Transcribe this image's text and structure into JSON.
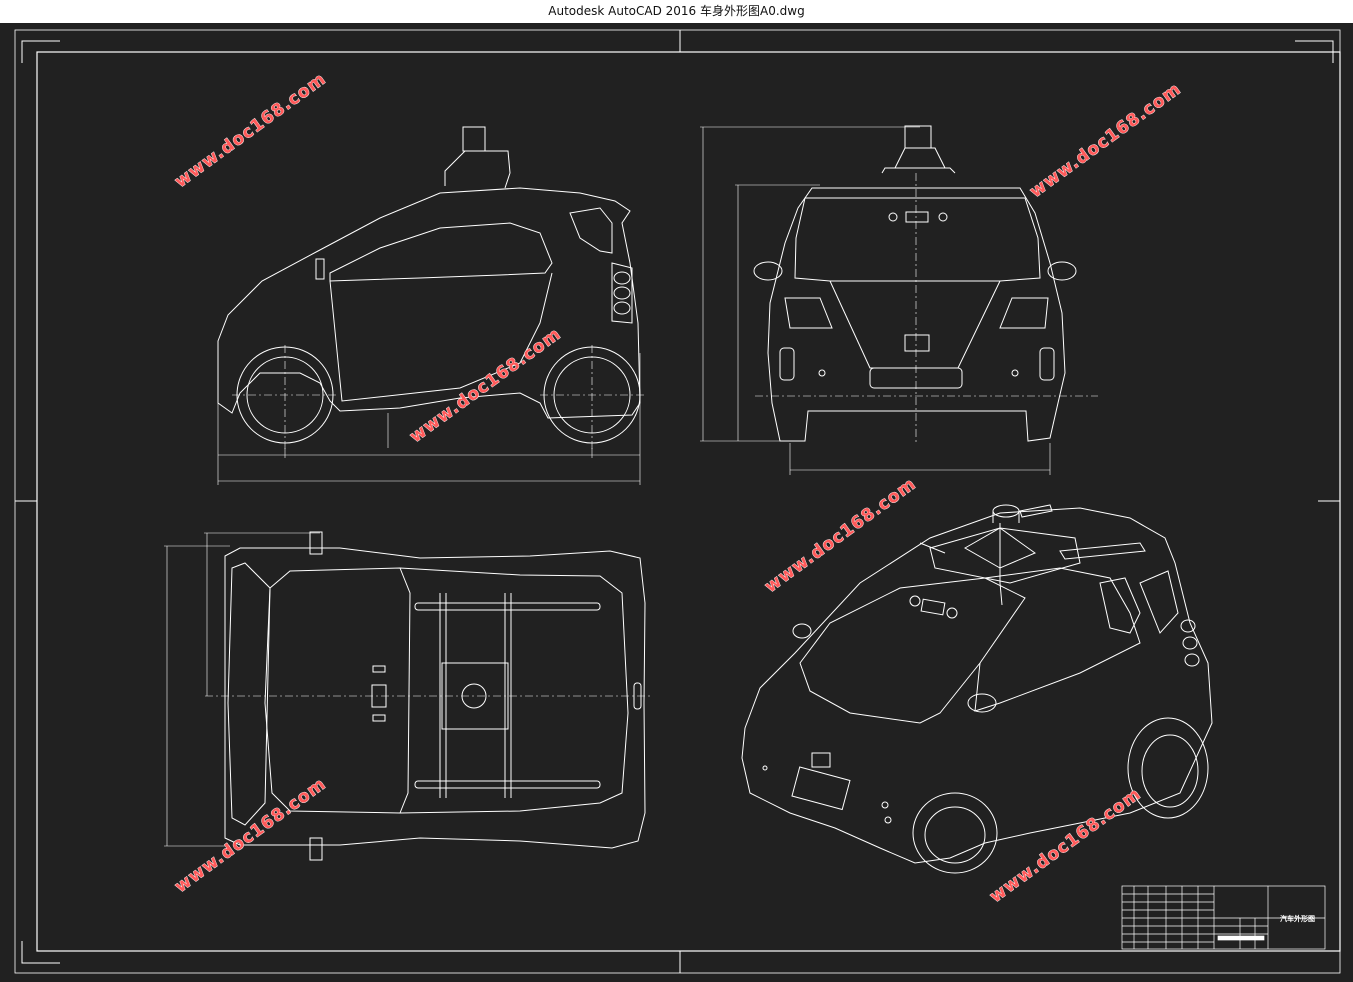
{
  "window": {
    "title": "Autodesk AutoCAD 2016    车身外形图A0.dwg"
  },
  "drawing": {
    "watermark": "www.doc168.com",
    "title_block": {
      "drawing_name": "汽车外形图"
    },
    "colors": {
      "background": "#212121",
      "lines": "#ffffff",
      "watermark": "#ff5a5a"
    }
  }
}
